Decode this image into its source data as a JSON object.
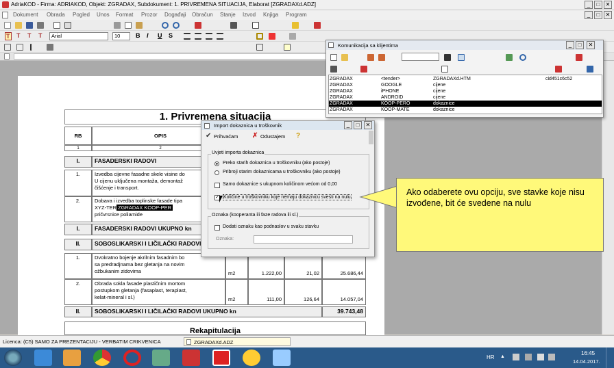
{
  "window": {
    "title": "AdriaKOD - Firma: ADRIAKOD,  Objekt: ZGRADAX,  Subdokument: 1. PRIVREMENA SITUACIJA,  Elaborat [ZGRADAXd.ADZ]",
    "minimize": "_",
    "maximize": "□",
    "close": "✕"
  },
  "menu": [
    "Dokument",
    "Obrada",
    "Pogled",
    "Unos",
    "Format",
    "Prozor",
    "Događaji",
    "Obračun",
    "Stanje",
    "Izvod",
    "Knjiga",
    "Program"
  ],
  "format": {
    "font": "Arial",
    "size": "10",
    "bold": "B",
    "italic": "I",
    "underline": "U",
    "strike": "S",
    "t_labels": [
      "T",
      "T",
      "T",
      "T"
    ]
  },
  "document": {
    "title": "1. Privremena situacija",
    "col_rb": "RB",
    "col_opis": "OPIS",
    "num1": "1",
    "num2": "2",
    "sections": [
      {
        "rb": "I.",
        "title": "FASADERSKI RADOVI"
      },
      {
        "rb": "I.",
        "title": "FASADERSKI RADOVI UKUPNO kn"
      },
      {
        "rb": "II.",
        "title": "SOBOSLIKARSKI I LIČILAČKI RADOVI"
      },
      {
        "rb": "II.",
        "title": "SOBOSLIKARSKI I LIČILAČKI RADOVI UKUPNO kn",
        "total": "39.743,48"
      }
    ],
    "items": [
      {
        "rb": "1.",
        "lines": [
          "Izvedba cijevne fasadne skele visine do",
          "U cijenu uključena montaža, demontaž",
          "čišćenje i transport."
        ]
      },
      {
        "rb": "2.",
        "lines": [
          "Dobava i izvedba toplinske fasade tipa",
          "XYZ-TER",
          "pričvrsnice poliamide"
        ],
        "highlight": "ZGRADAX          KOOP-PER"
      },
      {
        "rb": "1.",
        "lines": [
          "Dvokratno bojenje akrilnim fasadnim bo",
          "sa predradjnama bez gletanja na novim",
          "ožbukanim zidovima"
        ],
        "unit": "m2",
        "qty": "1.222,00",
        "price": "21,02",
        "total": "25.686,44"
      },
      {
        "rb": "2.",
        "lines": [
          "Obrada sokla fasade plastičnim mortom",
          "postupkom gletanja (fasaplast, teraplast,",
          "kelat-mineral i sl.)"
        ],
        "unit": "m2",
        "qty": "111,00",
        "price": "126,64",
        "total": "14.057,04"
      }
    ],
    "footer_partial": "Rekapitulacija"
  },
  "kom": {
    "title": "Komunikacija sa klijentima",
    "rows": [
      {
        "a": "ZGRADAX",
        "b": "<tender>",
        "c": "ZGRADAXd.HTM",
        "d": "cid451c6c52"
      },
      {
        "a": "ZGRADAX",
        "b": "GOOGLE",
        "c": "cijene",
        "d": ""
      },
      {
        "a": "ZGRADAX",
        "b": "iPHONE",
        "c": "cijene",
        "d": ""
      },
      {
        "a": "ZGRADAX",
        "b": "ANDROID",
        "c": "cijene",
        "d": ""
      },
      {
        "a": "ZGRADAX",
        "b": "KOOP-PERO",
        "c": "dokaznice",
        "d": "",
        "selected": true
      },
      {
        "a": "ZGRADAX",
        "b": "KOOP-MATE",
        "c": "dokaznice",
        "d": ""
      }
    ]
  },
  "dialog": {
    "title": "Import dokaznica u troškovnik",
    "accept": "Prihvaćam",
    "cancel": "Odustajem",
    "group1": "Uvjeti importa dokaznica",
    "opt1": "Preko starih dokaznica u troškovniku (ako postoje)",
    "opt2": "Pribroji starim dokaznicama u troškovniku (ako postoje)",
    "chk1": "Samo dokaznice s ukupnom količinom većom od 0,00",
    "chk2": "Količine u troškovniku koje nemaju dokaznicu svesti na nulu",
    "group2": "Oznaka (kooperanta ili faze radova ili sl.)",
    "chk3": "Dodati oznaku kao podnaslov u svaku stavku",
    "oznaka_label": "Oznaka:",
    "oznaka_value": ""
  },
  "callout": "Ako odaberete ovu opciju, sve stavke koje nisu izvođene, bit će svedene na nulu",
  "status": {
    "licence": "Licenca: (C5) SAMO ZA PREZENTACIJU - VERBATIM CRIKVENICA",
    "file": "ZGRADAXd.ADZ"
  },
  "taskbar": {
    "lang": "HR",
    "time": "16:45",
    "date": "14.04.2017."
  },
  "colors": {
    "callout": "#fff97a",
    "selection": "#000000",
    "taskbar": "#2a5a8a"
  }
}
